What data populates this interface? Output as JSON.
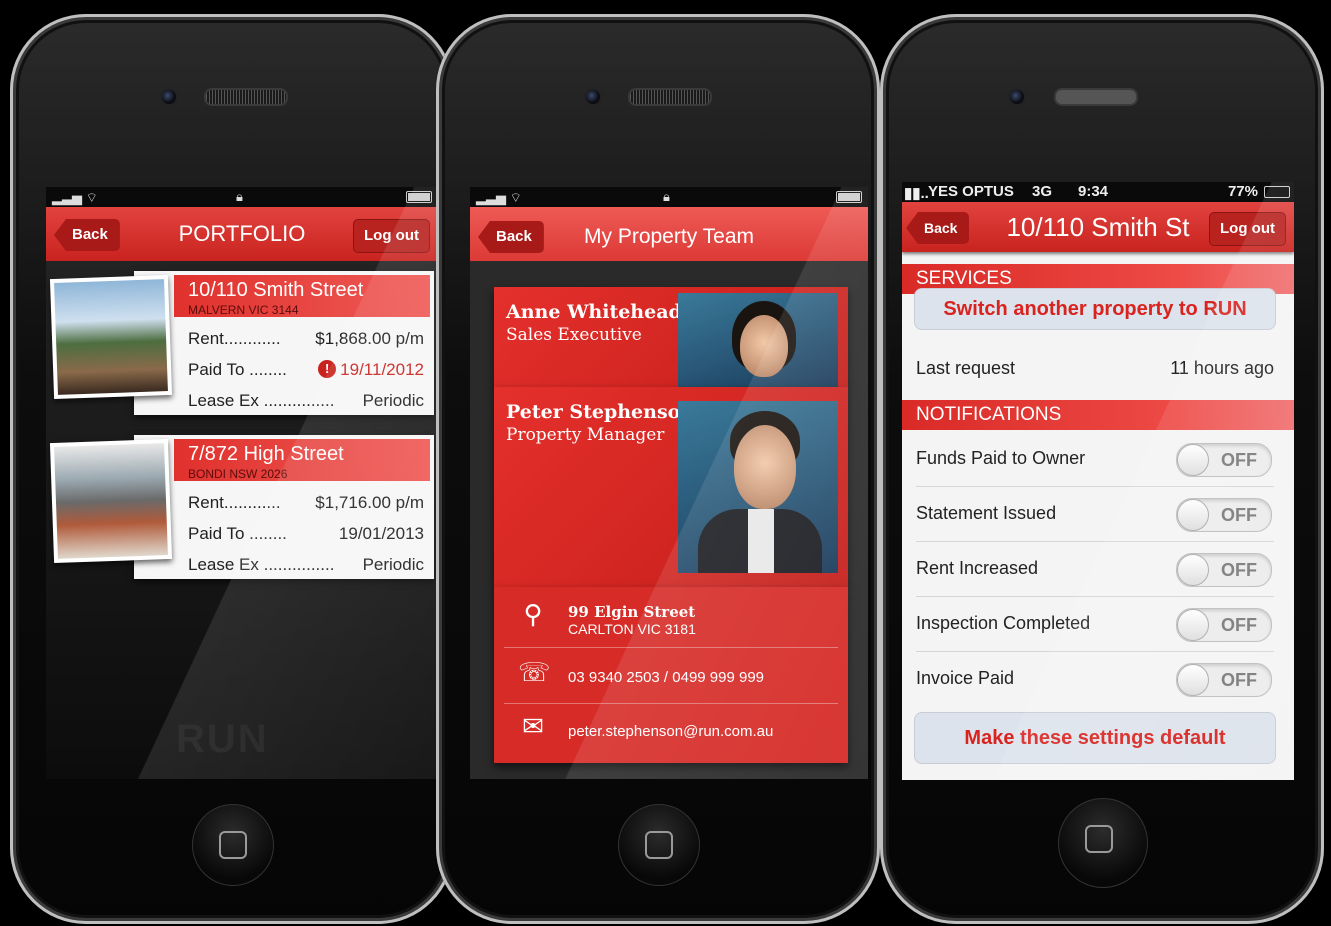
{
  "phone1": {
    "nav": {
      "back": "Back",
      "title": "PORTFOLIO",
      "logout": "Log out"
    },
    "properties": [
      {
        "street": "10/110 Smith Street",
        "suburb": "MALVERN VIC 3144",
        "rent_label": "Rent............",
        "rent_value": "$1,868.00 p/m",
        "paid_label": "Paid To ........",
        "paid_value": "19/11/2012",
        "paid_warning": true,
        "lease_label": "Lease Ex ...............",
        "lease_value": "Periodic"
      },
      {
        "street": "7/872 High Street",
        "suburb": "BONDI NSW 2026",
        "rent_label": "Rent............",
        "rent_value": "$1,716.00 p/m",
        "paid_label": "Paid To ........",
        "paid_value": "19/01/2013",
        "paid_warning": false,
        "lease_label": "Lease Ex ...............",
        "lease_value": "Periodic"
      }
    ],
    "watermark": "RUN"
  },
  "phone2": {
    "nav": {
      "back": "Back",
      "title": "My Property Team"
    },
    "people": [
      {
        "name": "Anne Whitehead",
        "role": "Sales Executive"
      },
      {
        "name": "Peter Stephenson",
        "role": "Property Manager"
      }
    ],
    "contact": {
      "address_line1": "99 Elgin Street",
      "address_line2": "CARLTON VIC 3181",
      "phone": "03 9340 2503 / 0499 999 999",
      "email": "peter.stephenson@run.com.au"
    }
  },
  "phone3": {
    "status": {
      "carrier": "YES OPTUS",
      "network": "3G",
      "time": "9:34",
      "battery": "77%"
    },
    "nav": {
      "back": "Back",
      "title": "10/110 Smith St",
      "logout": "Log out"
    },
    "services_header": "SERVICES",
    "switch_button": "Switch another property to RUN",
    "last_request_label": "Last request",
    "last_request_value": "11 hours ago",
    "notifications_header": "NOTIFICATIONS",
    "toggles": [
      {
        "label": "Funds Paid to Owner",
        "state": "OFF"
      },
      {
        "label": "Statement Issued",
        "state": "OFF"
      },
      {
        "label": "Rent Increased",
        "state": "OFF"
      },
      {
        "label": "Inspection Completed",
        "state": "OFF"
      },
      {
        "label": "Invoice Paid",
        "state": "OFF"
      }
    ],
    "default_button": "Make these settings default"
  },
  "colors": {
    "brand_red": "#d62b27",
    "accent_dark_red": "#a81a17",
    "button_bg": "#dde3ec"
  }
}
